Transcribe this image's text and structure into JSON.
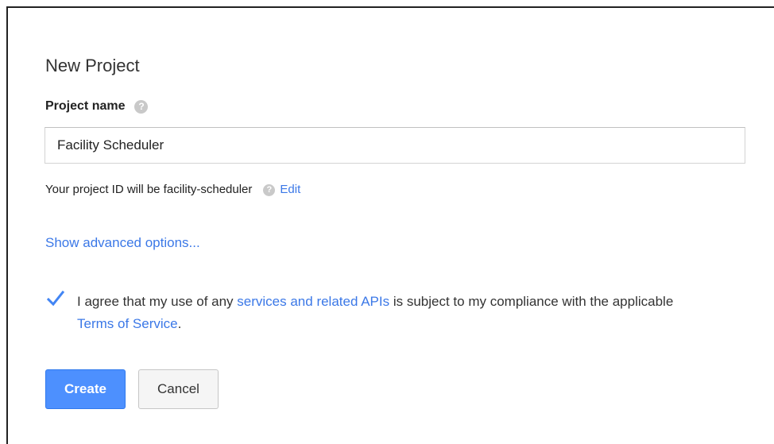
{
  "dialog": {
    "title": "New Project",
    "project_name": {
      "label": "Project name",
      "value": "Facility Scheduler",
      "help_icon": "help-icon"
    },
    "project_id": {
      "text": "Your project ID will be facility-scheduler",
      "help_icon": "help-icon",
      "edit_label": "Edit"
    },
    "advanced_link": "Show advanced options...",
    "agreement": {
      "checked": true,
      "part1": "I agree that my use of any ",
      "link1": "services and related APIs",
      "part2": " is subject to my compliance with the applicable ",
      "link2": "Terms of Service",
      "part3": "."
    },
    "buttons": {
      "create_label": "Create",
      "cancel_label": "Cancel"
    }
  },
  "colors": {
    "accent": "#4d90fe",
    "link": "#3b78e7",
    "checkmark": "#4285f4"
  }
}
